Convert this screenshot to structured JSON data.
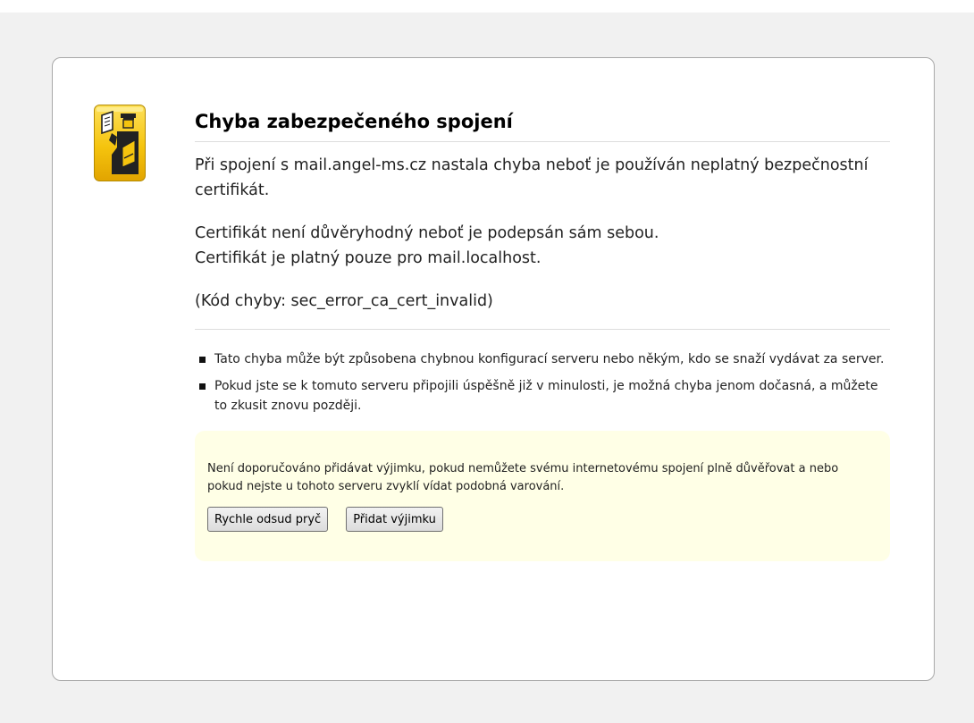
{
  "page": {
    "background": "#f1f1f1",
    "card_border": "#a8a8a8",
    "warning_background": "#ffffe6"
  },
  "icon": {
    "name": "security-officer-icon",
    "color": "#f5c40e"
  },
  "title": "Chyba zabezpečeného spojení",
  "description": {
    "line1": "Při spojení s mail.angel-ms.cz nastala chyba neboť je používán neplatný bezpečnostní certifikát.",
    "line2": "Certifikát není důvěryhodný neboť je podepsán sám sebou.",
    "line3": "Certifikát je platný pouze pro mail.localhost.",
    "error_code": "(Kód chyby: sec_error_ca_cert_invalid)"
  },
  "bullets": [
    "Tato chyba může být způsobena chybnou konfigurací serveru nebo někým, kdo se snaží vydávat za server.",
    "Pokud jste se k tomuto serveru připojili úspěšně již v minulosti, je možná chyba jenom dočasná, a můžete to zkusit znovu později."
  ],
  "warning": {
    "text": "Není doporučováno přidávat výjimku, pokud nemůžete svému internetovému spojení plně důvěřovat a nebo pokud nejste u tohoto serveru zvyklí vídat podobná varování.",
    "get_me_out_label": "Rychle odsud pryč",
    "add_exception_label": "Přidat výjimku"
  }
}
